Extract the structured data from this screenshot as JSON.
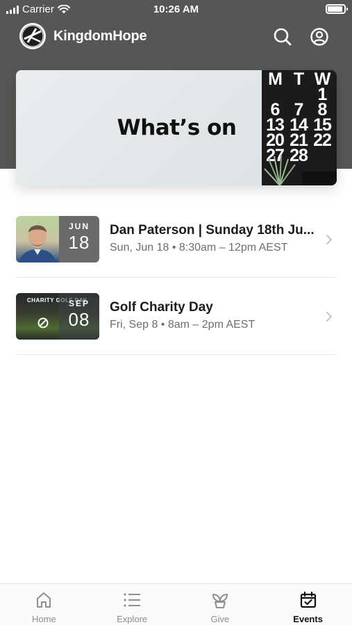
{
  "status_bar": {
    "carrier": "Carrier",
    "time": "10:26 AM"
  },
  "app": {
    "title": "KingdomHope"
  },
  "hero": {
    "title": "What’s on",
    "calendar_cells": [
      "M",
      "T",
      "W",
      "1",
      "6",
      "7",
      "8",
      "13",
      "14",
      "15",
      "20",
      "21",
      "22",
      "27",
      "28"
    ]
  },
  "events": [
    {
      "title": "Dan Paterson | Sunday 18th Ju...",
      "subtitle": "Sun, Jun 18 • 8:30am – 12pm AEST",
      "date_month": "JUN",
      "date_day": "18"
    },
    {
      "title": "Golf Charity Day",
      "subtitle": "Fri, Sep 8 • 8am – 2pm AEST",
      "date_month": "SEP",
      "date_day": "08",
      "thumb_caption": "CHARITY GOLF DAY"
    }
  ],
  "tabs": [
    {
      "label": "Home",
      "icon": "home-icon",
      "active": false
    },
    {
      "label": "Explore",
      "icon": "list-icon",
      "active": false
    },
    {
      "label": "Give",
      "icon": "plant-icon",
      "active": false
    },
    {
      "label": "Events",
      "icon": "calendar-check-icon",
      "active": true
    }
  ],
  "colors": {
    "header": "#555756",
    "active_tab": "#111111",
    "inactive_tab": "#8e8e93"
  }
}
